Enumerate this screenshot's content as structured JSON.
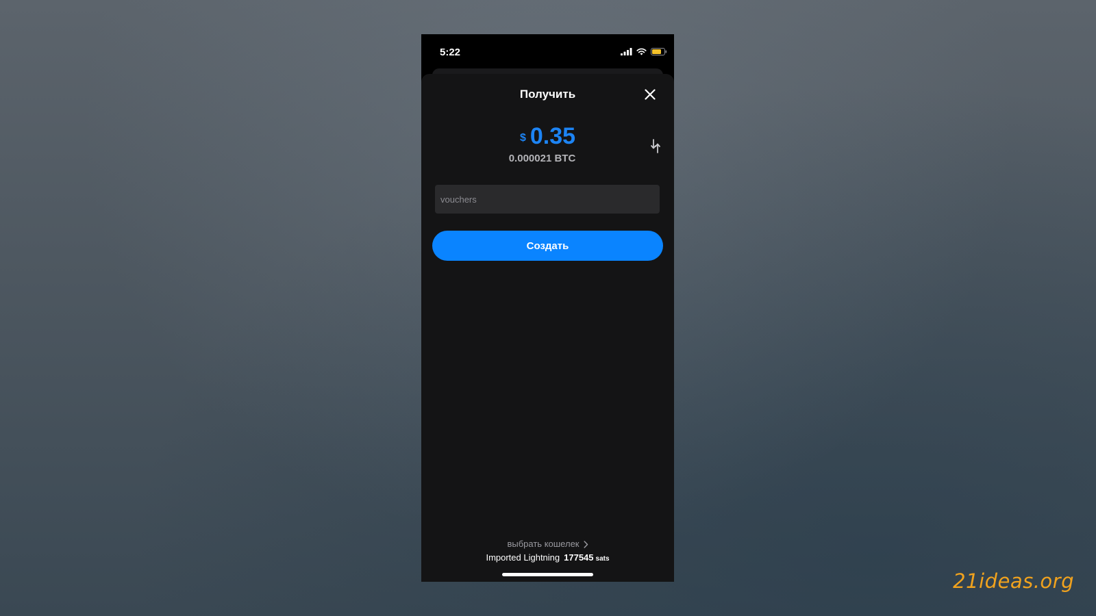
{
  "status_bar": {
    "time": "5:22",
    "icons": [
      "cellular-signal-icon",
      "wifi-icon",
      "battery-icon"
    ],
    "battery_color": "#f4c22b"
  },
  "sheet": {
    "title": "Получить",
    "close_icon": "close-icon"
  },
  "amount": {
    "currency_symbol": "$",
    "value": "0.35",
    "btc_equivalent": "0.000021 BTC",
    "swap_icon": "swap-units-icon",
    "accent_color": "#1d84f4"
  },
  "memo": {
    "placeholder": "vouchers",
    "value": ""
  },
  "create_button": {
    "label": "Создать",
    "color": "#0a84ff"
  },
  "wallet": {
    "select_label": "выбрать кошелек",
    "chevron_icon": "chevron-right-icon",
    "name": "Imported Lightning",
    "balance": "177545",
    "unit": "sats"
  },
  "branding": {
    "watermark": "21ideas.org",
    "watermark_color": "#f0a21e"
  }
}
